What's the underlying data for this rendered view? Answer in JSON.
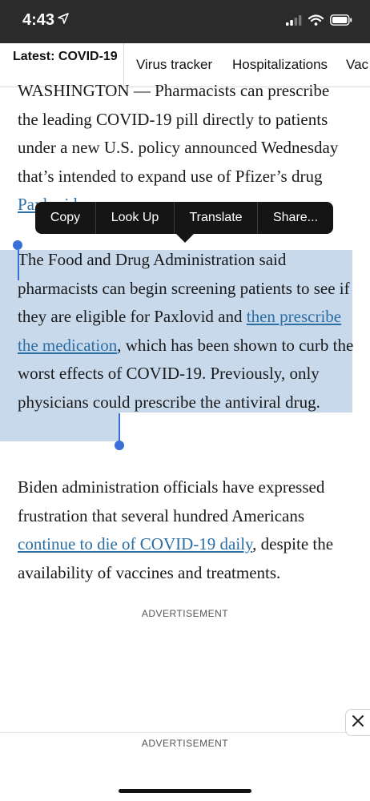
{
  "status_bar": {
    "time": "4:43",
    "icons": [
      "location-arrow-icon",
      "cellular-signal-icon",
      "wifi-icon",
      "battery-icon"
    ]
  },
  "nav": {
    "latest_label": "Latest: COVID-19",
    "items": [
      "Virus tracker",
      "Hospitalizations",
      "Vac"
    ]
  },
  "article": {
    "p1_text": "WASHINGTON — Pharmacists can prescribe the leading COVID-19 pill directly to patients under a new U.S. policy announced Wednesday that’s intended to expand use of Pfizer’s drug",
    "p1_link": "Paxlovid",
    "p2_text_a": "The Food and Drug Administration said pharmacists can begin screening patients to see if they are eligible for Paxlovid and ",
    "p2_link": "then prescribe the medication",
    "p2_text_b": ", which has been shown to curb the worst effects of COVID-19. Previously, only physicians could prescribe the antiviral drug.",
    "p3_text_a": "Biden administration officials have expressed frustration that several hundred Americans ",
    "p3_link": "continue to die of COVID-19 daily",
    "p3_text_b": ", despite the availability of vaccines and treatments."
  },
  "context_menu": {
    "items": [
      "Copy",
      "Look Up",
      "Translate",
      "Share..."
    ]
  },
  "ads": {
    "label_1": "ADVERTISEMENT",
    "label_2": "ADVERTISEMENT"
  },
  "colors": {
    "selection": "#c9d9ec",
    "link": "#2b6ea3",
    "handle": "#3a6fd8",
    "menu_bg": "#151515"
  }
}
